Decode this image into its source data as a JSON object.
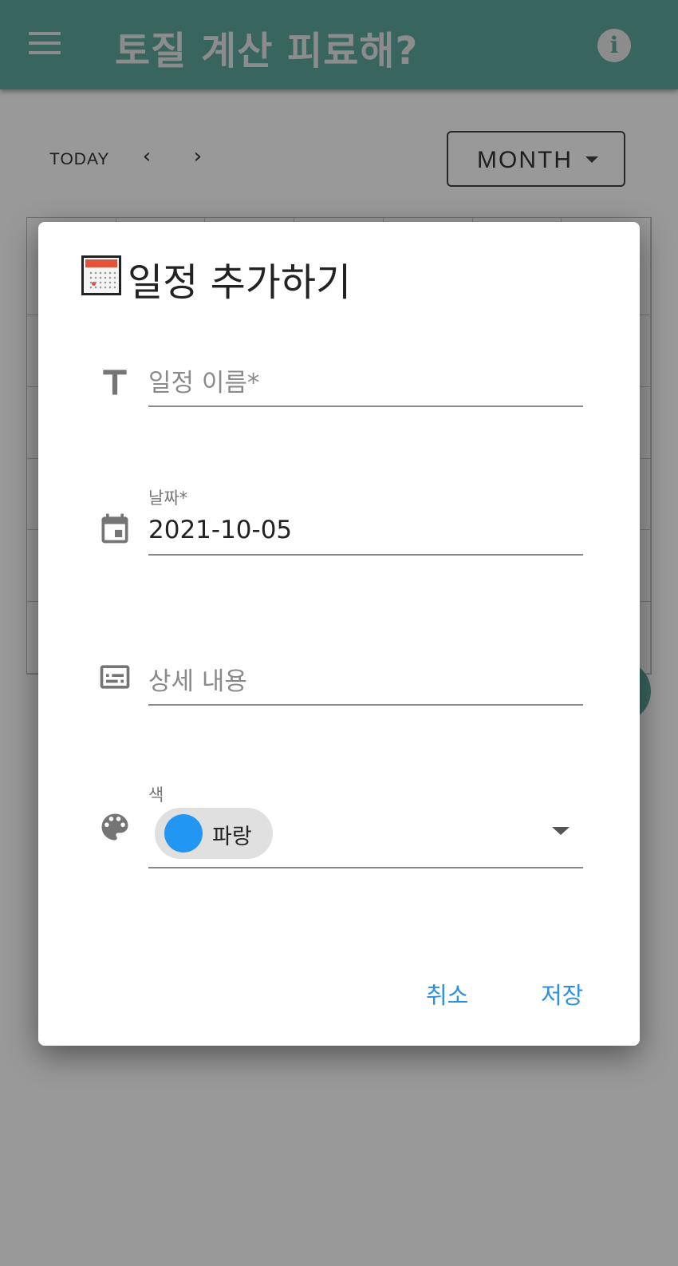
{
  "app": {
    "title": "토질 계산 피료해?",
    "menu_icon": "menu-icon",
    "info_icon": "info-icon",
    "accent_color": "#5fa89f"
  },
  "calendar_toolbar": {
    "today_label": "TODAY",
    "prev_icon": "chevron-left-icon",
    "next_icon": "chevron-right-icon",
    "view_select_value": "MONTH"
  },
  "dialog": {
    "title": "일정 추가하기",
    "title_icon": "calendar-icon",
    "fields": {
      "name": {
        "icon": "text-icon",
        "placeholder": "일정 이름*",
        "value": ""
      },
      "date": {
        "icon": "calendar-icon",
        "label": "날짜*",
        "value": "2021-10-05"
      },
      "details": {
        "icon": "subtitles-icon",
        "placeholder": "상세 내용",
        "value": ""
      },
      "color": {
        "icon": "palette-icon",
        "label": "색",
        "selected": "파랑",
        "swatch": "#2196f3"
      }
    },
    "actions": {
      "cancel": "취소",
      "save": "저장",
      "action_color": "#2f8fe0"
    }
  }
}
